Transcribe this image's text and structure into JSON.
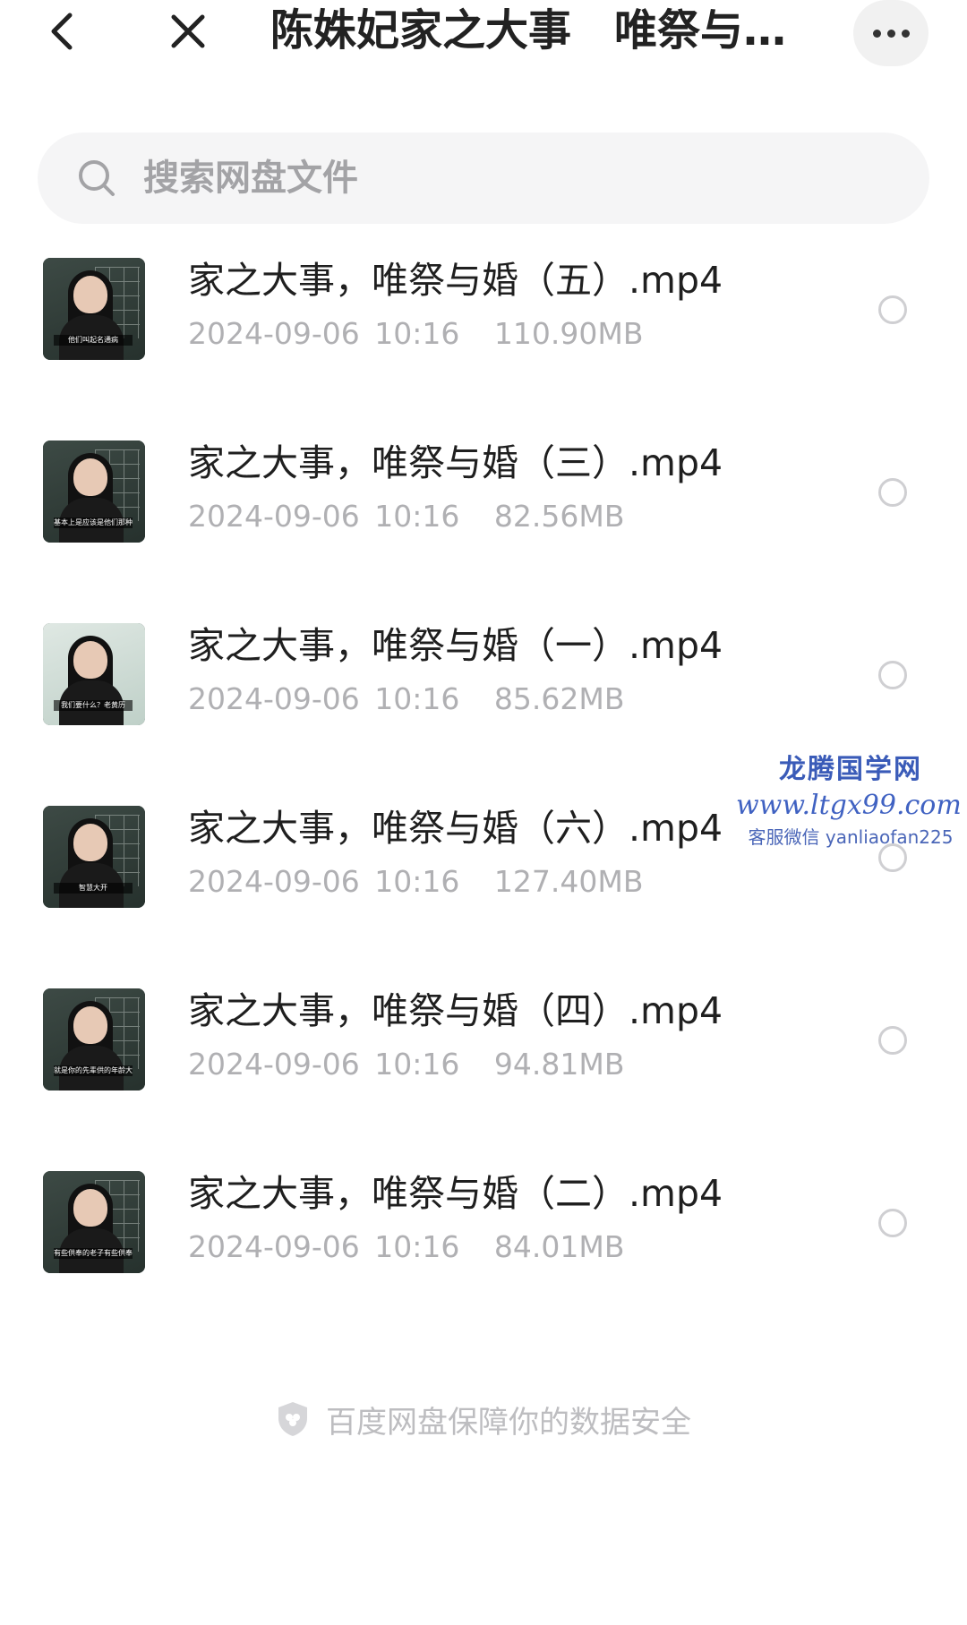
{
  "header": {
    "title": "陈姝妃家之大事　唯祭与…"
  },
  "search": {
    "placeholder": "搜索网盘文件"
  },
  "files": [
    {
      "name": "家之大事，唯祭与婚（五）.mp4",
      "date": "2024-09-06",
      "time": "10:16",
      "size": "110.90MB",
      "thumb_caption": "他们叫起名通病"
    },
    {
      "name": "家之大事，唯祭与婚（三）.mp4",
      "date": "2024-09-06",
      "time": "10:16",
      "size": "82.56MB",
      "thumb_caption": "基本上是应该是他们那种出来"
    },
    {
      "name": "家之大事，唯祭与婚（一）.mp4",
      "date": "2024-09-06",
      "time": "10:16",
      "size": "85.62MB",
      "thumb_caption": "我们要什么？老黄历"
    },
    {
      "name": "家之大事，唯祭与婚（六）.mp4",
      "date": "2024-09-06",
      "time": "10:16",
      "size": "127.40MB",
      "thumb_caption": "智慧大开"
    },
    {
      "name": "家之大事，唯祭与婚（四）.mp4",
      "date": "2024-09-06",
      "time": "10:16",
      "size": "94.81MB",
      "thumb_caption": "就是你的先辈供的年龄大的"
    },
    {
      "name": "家之大事，唯祭与婚（二）.mp4",
      "date": "2024-09-06",
      "time": "10:16",
      "size": "84.01MB",
      "thumb_caption": "有些供奉的老子有些供奉的孔子"
    }
  ],
  "watermark": {
    "title": "龙腾国学网",
    "url": "www.ltgx99.com",
    "contact": "客服微信 yanliaofan225"
  },
  "footer": {
    "text": "百度网盘保障你的数据安全"
  },
  "colors": {
    "background": "#ffffff",
    "search_bg": "#f5f5f6",
    "meta_text": "#b0b0b3",
    "watermark": "#3a5bb8"
  }
}
